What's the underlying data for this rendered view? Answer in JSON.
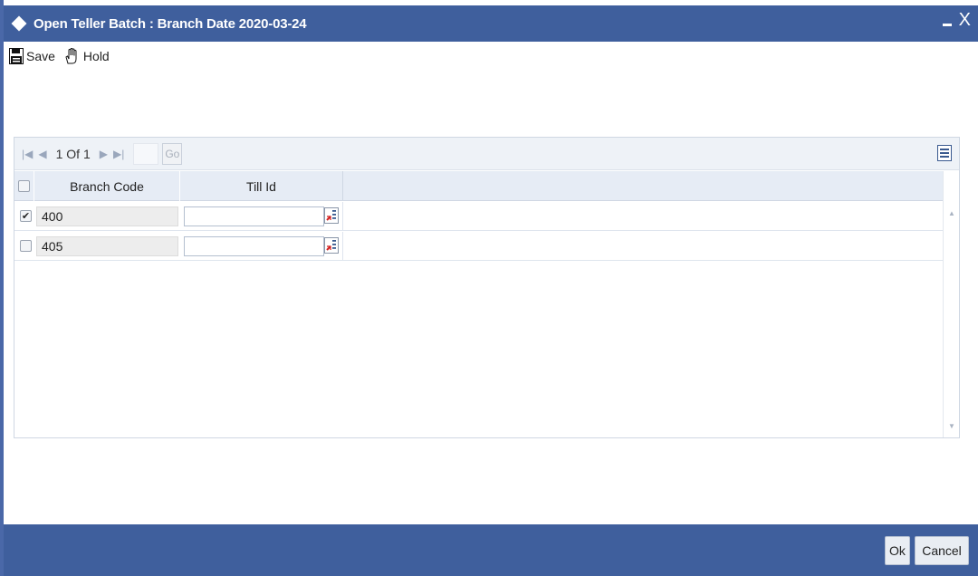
{
  "window": {
    "title": "Open Teller Batch : Branch Date 2020-03-24",
    "close_glyph": "X"
  },
  "toolbar": {
    "save_label": "Save",
    "hold_label": "Hold"
  },
  "pager": {
    "page_text": "1 Of 1",
    "go_label": "Go"
  },
  "grid": {
    "columns": [
      "Branch Code",
      "Till Id"
    ],
    "rows": [
      {
        "checked": true,
        "branch_code": "400",
        "till_id": ""
      },
      {
        "checked": false,
        "branch_code": "405",
        "till_id": ""
      }
    ]
  },
  "footer": {
    "ok_label": "Ok",
    "cancel_label": "Cancel"
  },
  "colors": {
    "titlebar": "#3f5f9d",
    "header_row": "#e6ecf5",
    "lov_icon": "#d21f1f"
  }
}
